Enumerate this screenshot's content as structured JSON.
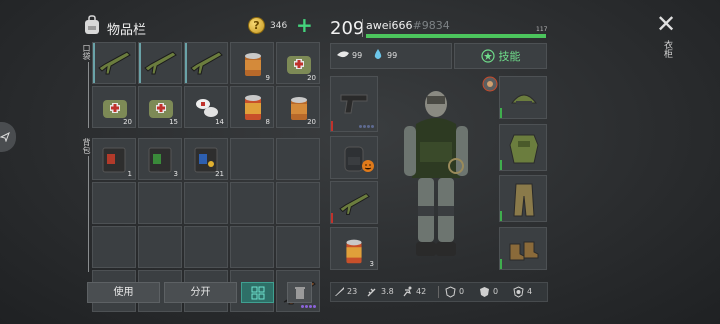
{
  "header": {
    "title": "物品栏",
    "coins": "346"
  },
  "sections": {
    "pocket": "口袋",
    "backpack": "背包"
  },
  "pocket_counts": [
    "",
    "",
    "",
    "9",
    "20",
    "20",
    "15",
    "14",
    "8",
    "20"
  ],
  "backpack_counts": [
    "1",
    "3",
    "21",
    "",
    "",
    "",
    "",
    "",
    "",
    "",
    "",
    "",
    "",
    "",
    "",
    "",
    "",
    "",
    "",
    ""
  ],
  "buttons": {
    "use": "使用",
    "split": "分开"
  },
  "player": {
    "level": "209",
    "name": "awei666",
    "id": "#9834",
    "xp_value": "117",
    "xp_fraction": 0.99,
    "food": "99",
    "water": "99",
    "skills_label": "技能"
  },
  "equipment_counts": {
    "food_slot": "3"
  },
  "bottom_stats": {
    "attack": "23",
    "speed": "3.8",
    "move": "42",
    "armor": "0",
    "shield": "0",
    "resist": "4"
  },
  "right_side": {
    "vertical_label": "衣柜"
  },
  "colors": {
    "accent_green": "#4cc55d",
    "teal": "#2e6f67",
    "rarity_purple": "#8b63d8"
  }
}
